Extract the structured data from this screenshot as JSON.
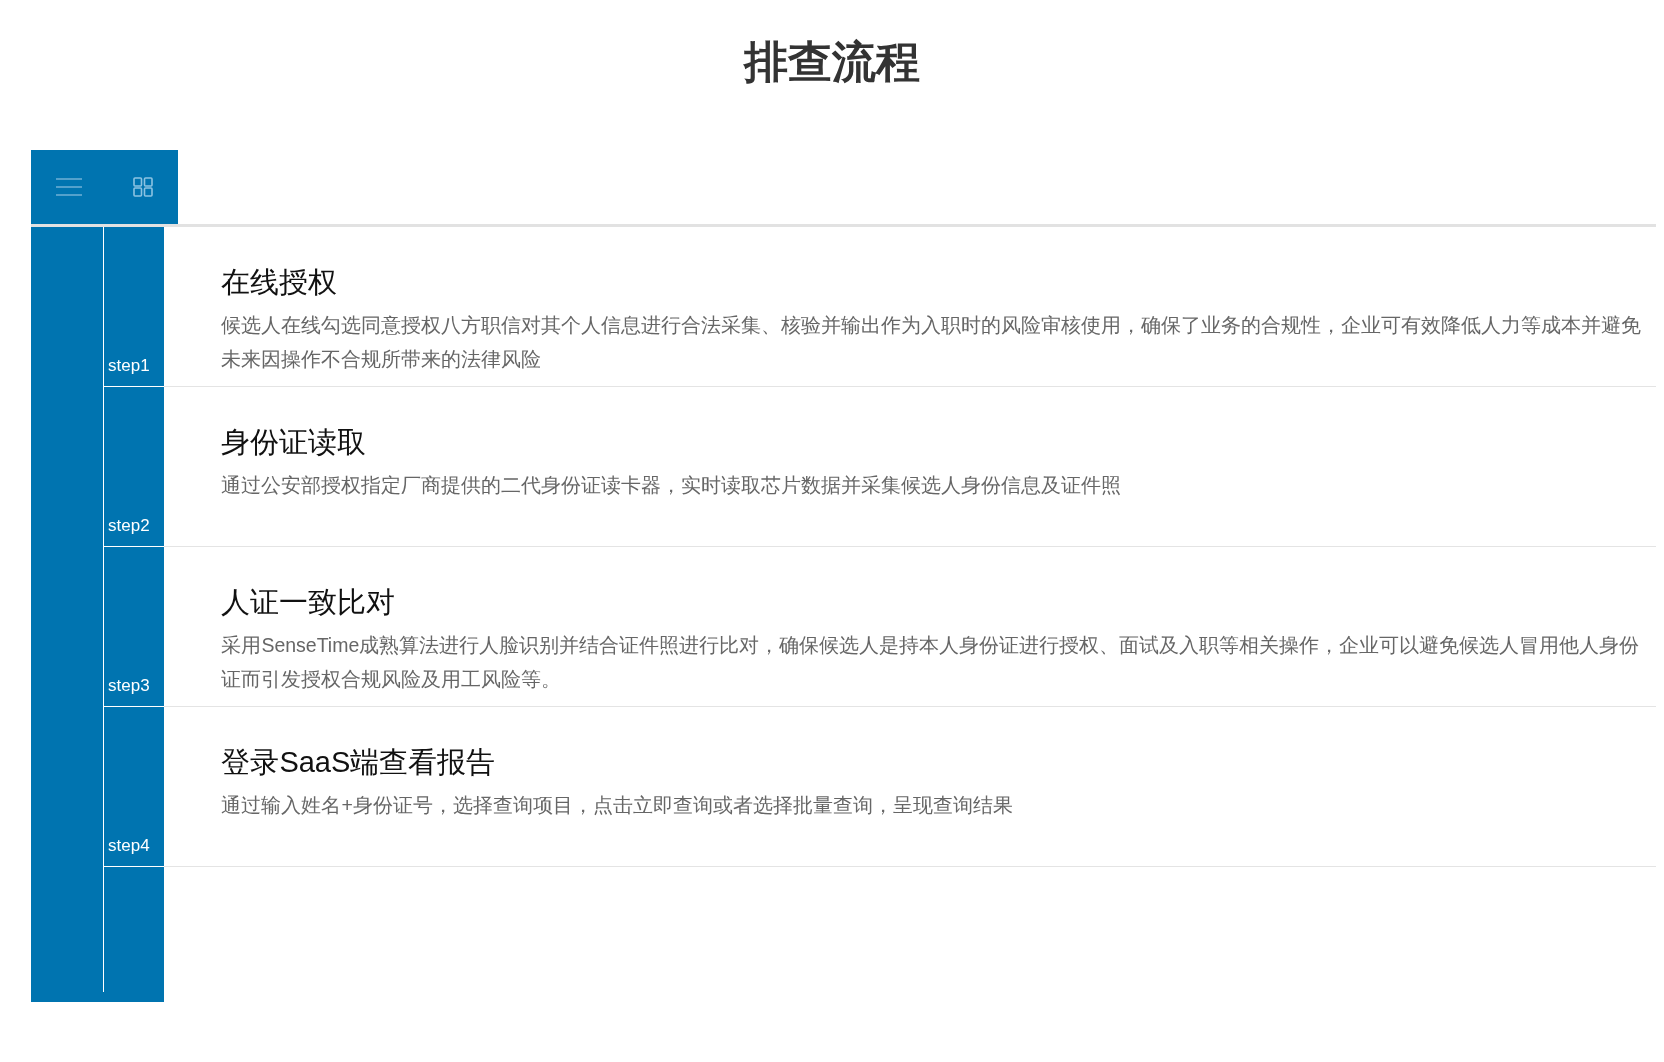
{
  "page": {
    "title": "排查流程"
  },
  "steps": [
    {
      "label": "step1",
      "title": "在线授权",
      "description": "候选人在线勾选同意授权八方职信对其个人信息进行合法采集、核验并输出作为入职时的风险审核使用，确保了业务的合规性，企业可有效降低人力等成本并避免未来因操作不合规所带来的法律风险"
    },
    {
      "label": "step2",
      "title": "身份证读取",
      "description": "通过公安部授权指定厂商提供的二代身份证读卡器，实时读取芯片数据并采集候选人身份信息及证件照"
    },
    {
      "label": "step3",
      "title": "人证一致比对",
      "description": "采用SenseTime成熟算法进行人脸识别并结合证件照进行比对，确保候选人是持本人身份证进行授权、面试及入职等相关操作，企业可以避免候选人冒用他人身份证而引发授权合规风险及用工风险等。"
    },
    {
      "label": "step4",
      "title": "登录SaaS端查看报告",
      "description": "通过输入姓名+身份证号，选择查询项目，点击立即查询或者选择批量查询，呈现查询结果"
    }
  ]
}
